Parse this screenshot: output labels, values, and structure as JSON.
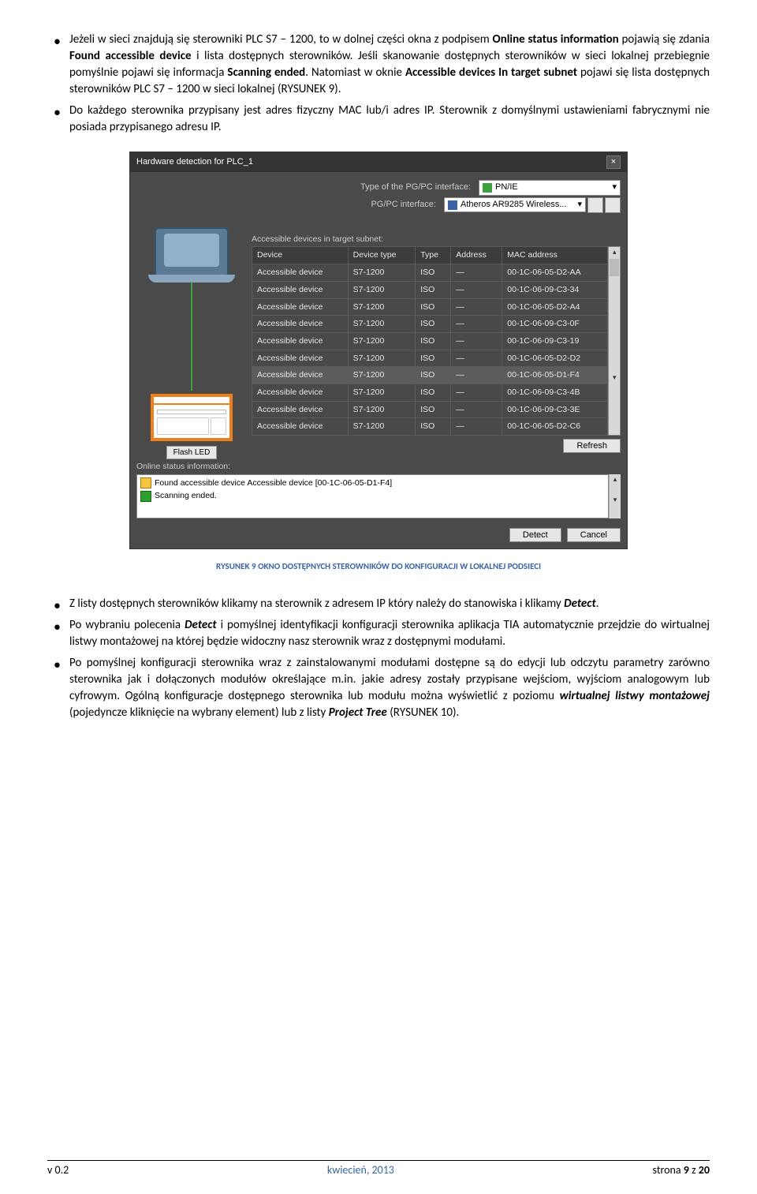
{
  "para1": {
    "p1": "Jeżeli w sieci znajdują się sterowniki PLC S7 – 1200, to w dolnej części okna z podpisem ",
    "b1": "Online status information",
    "p2": " pojawią się zdania ",
    "b2": "Found accessible device",
    "p3": " i lista dostępnych sterowników. Jeśli skanowanie dostępnych sterowników w sieci lokalnej przebiegnie pomyślnie pojawi się informacja ",
    "b3": "Scanning ended",
    "p4": ". Natomiast w oknie ",
    "b4": "Accessible devices In target subnet",
    "p5": " pojawi się lista dostępnych sterowników PLC S7 – 1200 w sieci lokalnej (R",
    "sc1": "YSUNEK",
    "p6": " 9)."
  },
  "para2": "Do każdego sterownika przypisany jest adres fizyczny MAC lub/i adres IP. Sterownik z domyślnymi ustawieniami fabrycznymi nie posiada przypisanego adresu IP.",
  "caption1": "RYSUNEK 9 OKNO DOSTĘPNYCH STEROWNIKÓW DO KONFIGURACJI W LOKALNEJ PODSIECI",
  "para3": {
    "p1": "Z listy dostępnych sterowników klikamy na sterownik z adresem IP który należy do stanowiska i klikamy ",
    "b1": "Detect",
    "p2": "."
  },
  "para4": {
    "p1": "Po wybraniu polecenia ",
    "b1": "Detect",
    "p2": " i pomyślnej identyfikacji konfiguracji sterownika aplikacja TIA automatycznie przejdzie do wirtualnej listwy montażowej na której będzie widoczny nasz sterownik wraz z dostępnymi modułami."
  },
  "para5": {
    "p1": "Po pomyślnej konfiguracji sterownika wraz z zainstalowanymi modułami dostępne są do edycji lub odczytu parametry zarówno sterownika jak i dołączonych modułów określające m.in. jakie adresy zostały przypisane wejściom, wyjściom analogowym lub cyfrowym. Ogólną konfiguracje dostępnego sterownika lub modułu można wyświetlić z poziomu ",
    "b1": "wirtualnej listwy montażowej",
    "p2": " (pojedyncze kliknięcie na wybrany element) lub z listy ",
    "b2": "Project Tree",
    "p3": " (R",
    "sc1": "YSUNEK",
    "p4": " 10)."
  },
  "dialog": {
    "title": "Hardware detection for PLC_1",
    "type_label": "Type of the PG/PC interface:",
    "type_value": "PN/IE",
    "iface_label": "PG/PC interface:",
    "iface_value": "Atheros AR9285 Wireless...",
    "subnet_label": "Accessible devices in target subnet:",
    "headers": {
      "h1": "Device",
      "h2": "Device type",
      "h3": "Type",
      "h4": "Address",
      "h5": "MAC address"
    },
    "rows": [
      {
        "dev": "Accessible device",
        "dt": "S7-1200",
        "t": "ISO",
        "a": "—",
        "mac": "00-1C-06-05-D2-AA"
      },
      {
        "dev": "Accessible device",
        "dt": "S7-1200",
        "t": "ISO",
        "a": "—",
        "mac": "00-1C-06-09-C3-34"
      },
      {
        "dev": "Accessible device",
        "dt": "S7-1200",
        "t": "ISO",
        "a": "—",
        "mac": "00-1C-06-05-D2-A4"
      },
      {
        "dev": "Accessible device",
        "dt": "S7-1200",
        "t": "ISO",
        "a": "—",
        "mac": "00-1C-06-09-C3-0F"
      },
      {
        "dev": "Accessible device",
        "dt": "S7-1200",
        "t": "ISO",
        "a": "—",
        "mac": "00-1C-06-09-C3-19"
      },
      {
        "dev": "Accessible device",
        "dt": "S7-1200",
        "t": "ISO",
        "a": "—",
        "mac": "00-1C-06-05-D2-D2"
      },
      {
        "dev": "Accessible device",
        "dt": "S7-1200",
        "t": "ISO",
        "a": "—",
        "mac": "00-1C-06-05-D1-F4"
      },
      {
        "dev": "Accessible device",
        "dt": "S7-1200",
        "t": "ISO",
        "a": "—",
        "mac": "00-1C-06-09-C3-4B"
      },
      {
        "dev": "Accessible device",
        "dt": "S7-1200",
        "t": "ISO",
        "a": "—",
        "mac": "00-1C-06-09-C3-3E"
      },
      {
        "dev": "Accessible device",
        "dt": "S7-1200",
        "t": "ISO",
        "a": "—",
        "mac": "00-1C-06-05-D2-C6"
      }
    ],
    "flash_btn": "Flash LED",
    "refresh_btn": "Refresh",
    "status_label": "Online status information:",
    "status1": "Found accessible device Accessible device [00-1C-06-05-D1-F4]",
    "status2": "Scanning ended.",
    "detect_btn": "Detect",
    "cancel_btn": "Cancel"
  },
  "footer": {
    "left": "v 0.2",
    "mid": "kwiecień, 2013",
    "right_a": "strona ",
    "right_b": "9",
    "right_c": " z ",
    "right_d": "20"
  }
}
